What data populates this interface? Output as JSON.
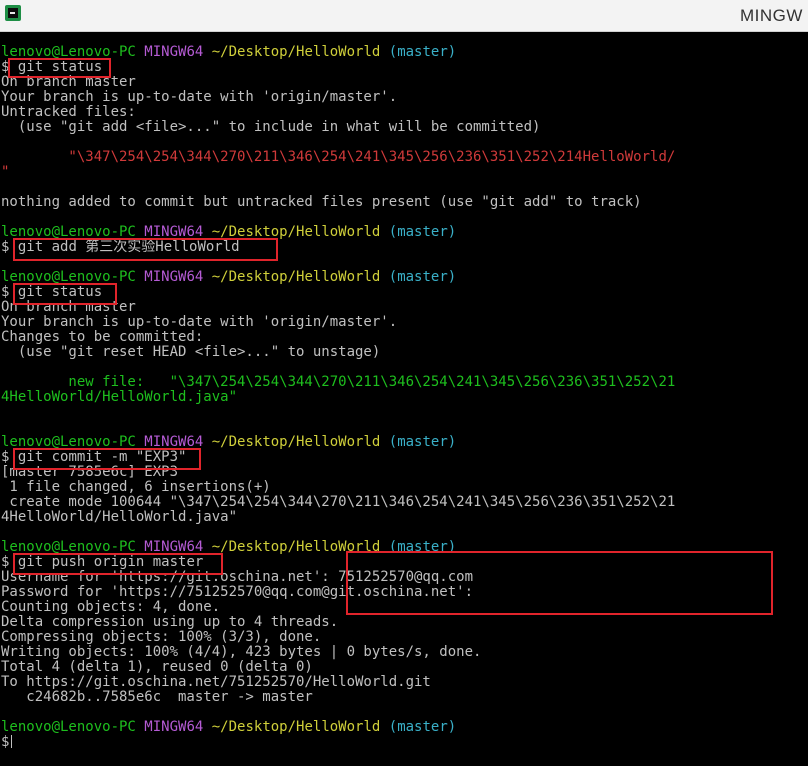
{
  "window": {
    "title": "MINGW"
  },
  "prompt": {
    "user": "lenovo@Lenovo-PC",
    "env": "MINGW64",
    "path": "~/Desktop/HelloWorld",
    "branch": "(master)",
    "symbol": "$"
  },
  "lines": {
    "cmd1": "git status",
    "s1_1": "On branch master",
    "s1_2": "Your branch is up-to-date with 'origin/master'.",
    "s1_3": "Untracked files:",
    "s1_4": "  (use \"git add <file>...\" to include in what will be committed)",
    "s1_5": "        \"\\347\\254\\254\\344\\270\\211\\346\\254\\241\\345\\256\\236\\351\\252\\214HelloWorld/",
    "s1_6": "\"",
    "s1_7": "nothing added to commit but untracked files present (use \"git add\" to track)",
    "cmd2": "git add 第三次实验HelloWorld",
    "cmd3": "git status",
    "s3_1": "On branch master",
    "s3_2": "Your branch is up-to-date with 'origin/master'.",
    "s3_3": "Changes to be committed:",
    "s3_4": "  (use \"git reset HEAD <file>...\" to unstage)",
    "s3_5": "        new file:   \"\\347\\254\\254\\344\\270\\211\\346\\254\\241\\345\\256\\236\\351\\252\\21",
    "s3_6": "4HelloWorld/HelloWorld.java\"",
    "cmd4": "git commit -m \"EXP3\"",
    "s4_1": "[master 7585e6c] EXP3",
    "s4_2": " 1 file changed, 6 insertions(+)",
    "s4_3": " create mode 100644 \"\\347\\254\\254\\344\\270\\211\\346\\254\\241\\345\\256\\236\\351\\252\\21",
    "s4_4": "4HelloWorld/HelloWorld.java\"",
    "cmd5": "git push origin master",
    "s5_1": "Username for 'https://git.oschina.net': 751252570@qq.com",
    "s5_2": "Password for 'https://751252570@qq.com@git.oschina.net':",
    "s5_3": "Counting objects: 4, done.",
    "s5_4": "Delta compression using up to 4 threads.",
    "s5_5": "Compressing objects: 100% (3/3), done.",
    "s5_6": "Writing objects: 100% (4/4), 423 bytes | 0 bytes/s, done.",
    "s5_7": "Total 4 (delta 1), reused 0 (delta 0)",
    "s5_8": "To https://git.oschina.net/751252570/HelloWorld.git",
    "s5_9": "   c24682b..7585e6c  master -> master"
  },
  "colors": {
    "background": "#000000",
    "text": "#c0c0c0",
    "user": "#1ebf1e",
    "env": "#b55bd4",
    "path": "#cfcf3a",
    "branch": "#3ab0c8",
    "untracked": "#d03a3a",
    "staged": "#1ebf1e",
    "highlight_box": "#e0242b"
  }
}
